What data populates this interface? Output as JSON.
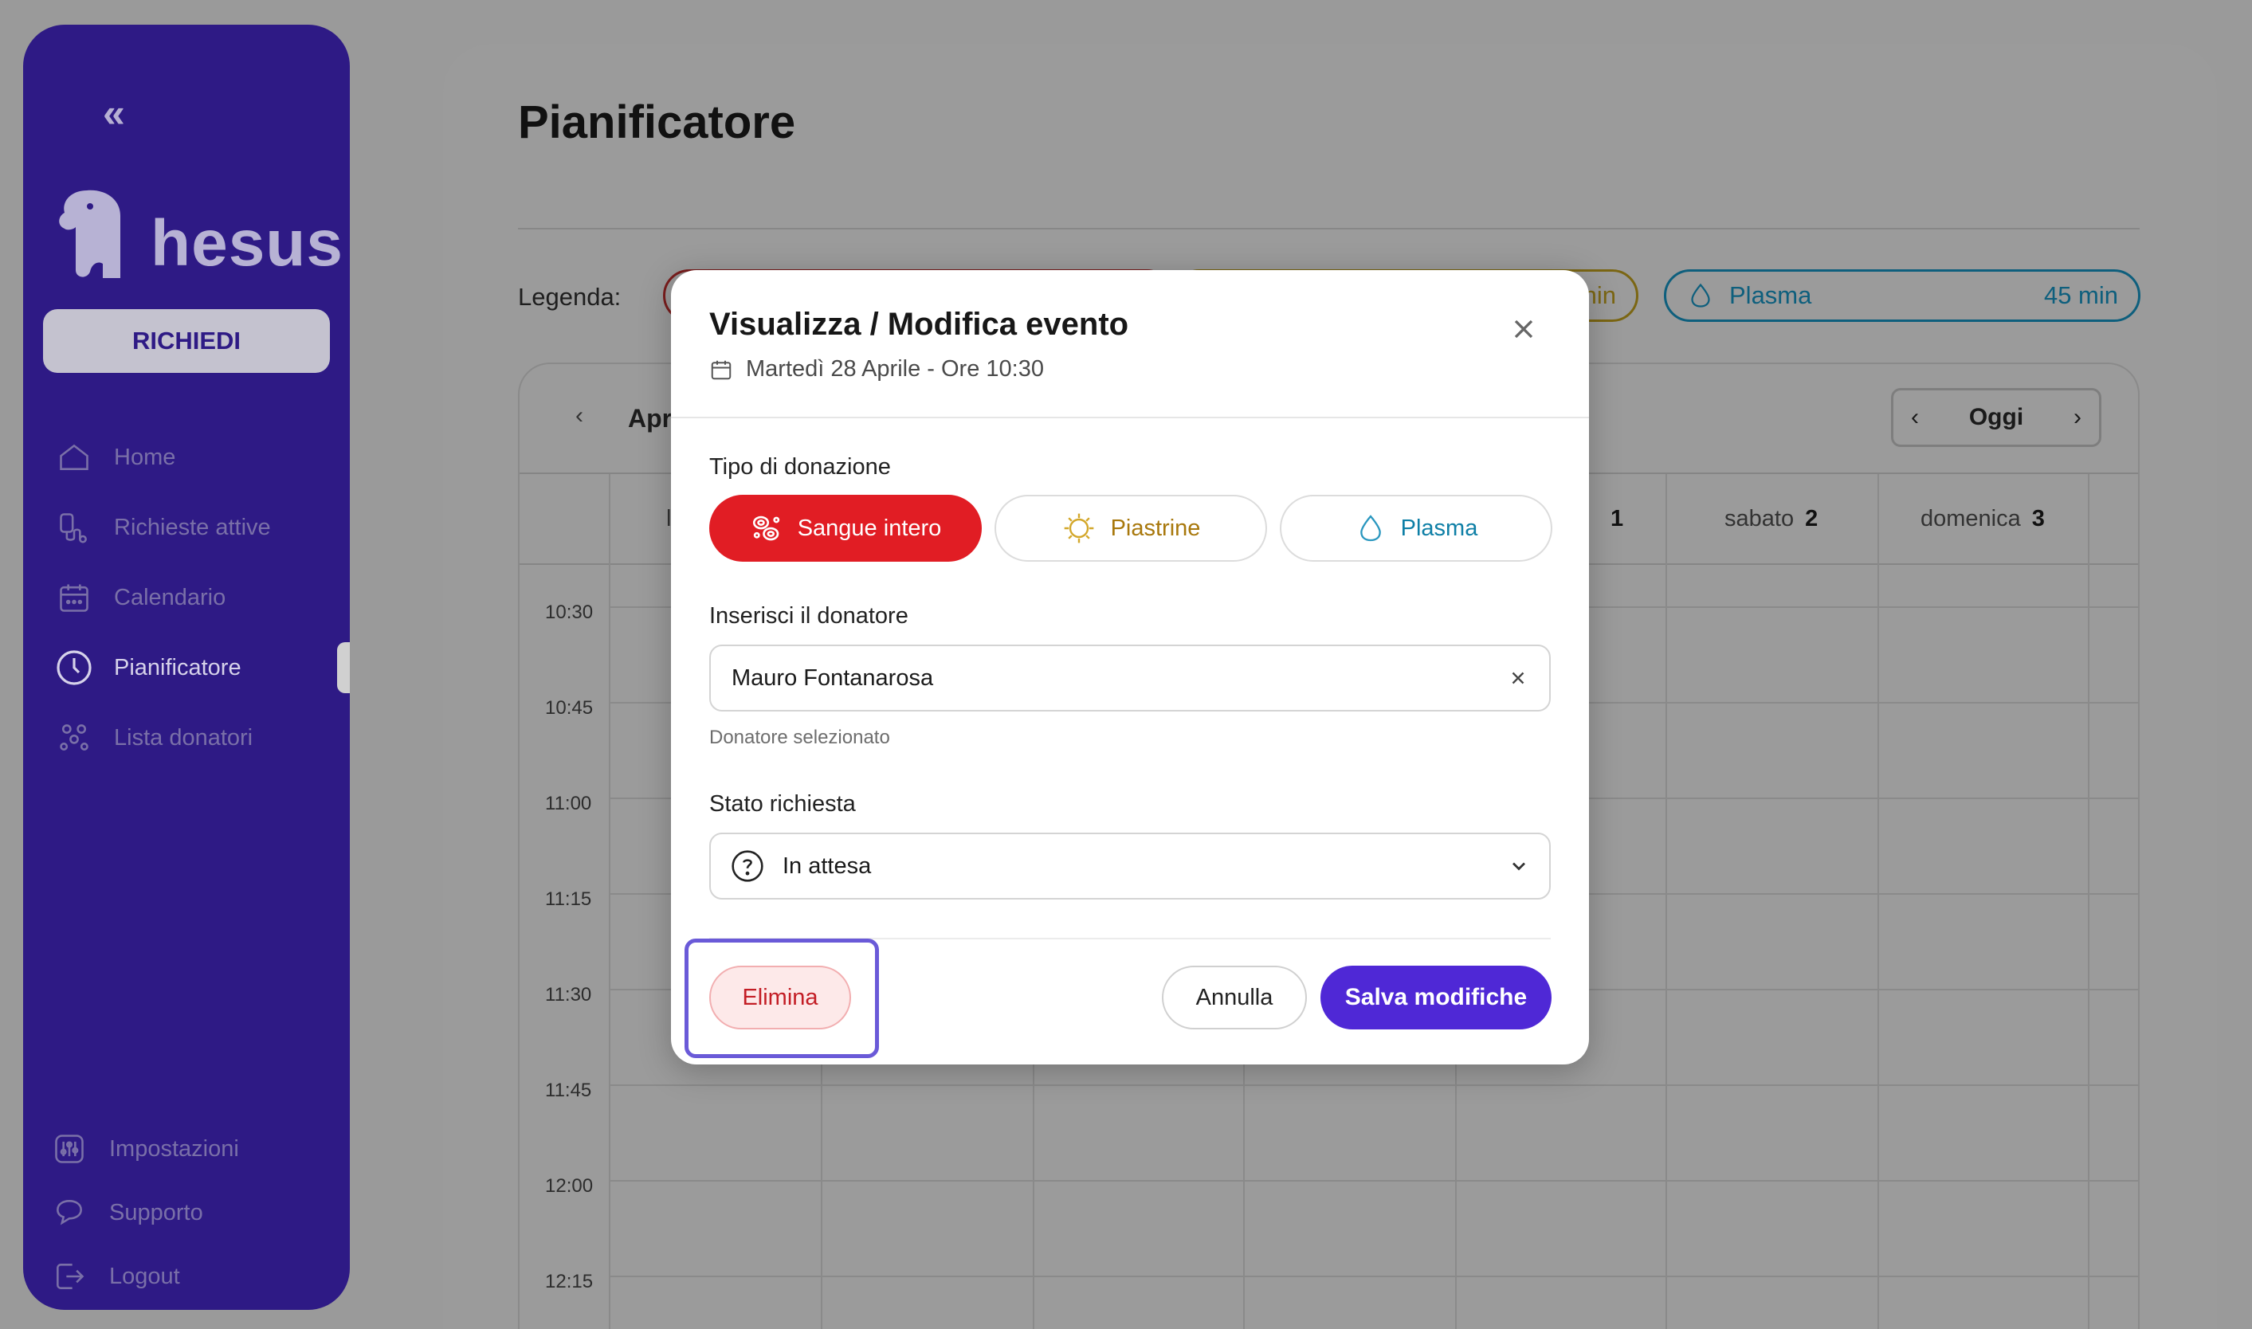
{
  "sidebar": {
    "logo_text": "hesus",
    "request_button": "RICHIEDI",
    "nav": [
      {
        "label": "Home",
        "icon": "home-icon"
      },
      {
        "label": "Richieste attive",
        "icon": "request-icon"
      },
      {
        "label": "Calendario",
        "icon": "calendar-icon"
      },
      {
        "label": "Pianificatore",
        "icon": "clock-icon",
        "active": true
      },
      {
        "label": "Lista donatori",
        "icon": "donors-icon"
      }
    ],
    "bottom_nav": [
      {
        "label": "Impostazioni",
        "icon": "settings-icon"
      },
      {
        "label": "Supporto",
        "icon": "support-icon"
      },
      {
        "label": "Logout",
        "icon": "logout-icon"
      }
    ]
  },
  "page": {
    "title": "Pianificatore",
    "legend_label": "Legenda:",
    "legend": [
      {
        "name": "",
        "duration": "",
        "color": "#e11d24"
      },
      {
        "name": "",
        "duration": "nin",
        "color": "#a8780c"
      },
      {
        "name": "Plasma",
        "duration": "45 min",
        "color": "#0e7fa6"
      }
    ]
  },
  "calendar": {
    "month_label": "Apr",
    "today_label": "Oggi",
    "day_headers": [
      {
        "name": "l",
        "date": ""
      },
      {
        "name": "",
        "date": "1"
      },
      {
        "name": "sabato",
        "date": "2"
      },
      {
        "name": "domenica",
        "date": "3"
      }
    ],
    "times": [
      "10:30",
      "10:45",
      "11:00",
      "11:15",
      "11:30",
      "11:45",
      "12:00",
      "12:15"
    ]
  },
  "modal": {
    "title": "Visualizza / Modifica evento",
    "date": "Martedì 28 Aprile - Ore 10:30",
    "donation_type_label": "Tipo di donazione",
    "donation_types": [
      {
        "label": "Sangue intero",
        "selected": true,
        "color": "#e11d24"
      },
      {
        "label": "Piastrine",
        "selected": false,
        "color": "#a8780c"
      },
      {
        "label": "Plasma",
        "selected": false,
        "color": "#0e7fa6"
      }
    ],
    "donor_label": "Inserisci il donatore",
    "donor_value": "Mauro Fontanarosa",
    "donor_helper": "Donatore selezionato",
    "status_label": "Stato richiesta",
    "status_value": "In attesa",
    "delete_button": "Elimina",
    "cancel_button": "Annulla",
    "save_button": "Salva modifiche"
  },
  "colors": {
    "sidebar_bg": "#2e1a85",
    "accent": "#4f28d6",
    "highlight": "#6a5ad8"
  }
}
